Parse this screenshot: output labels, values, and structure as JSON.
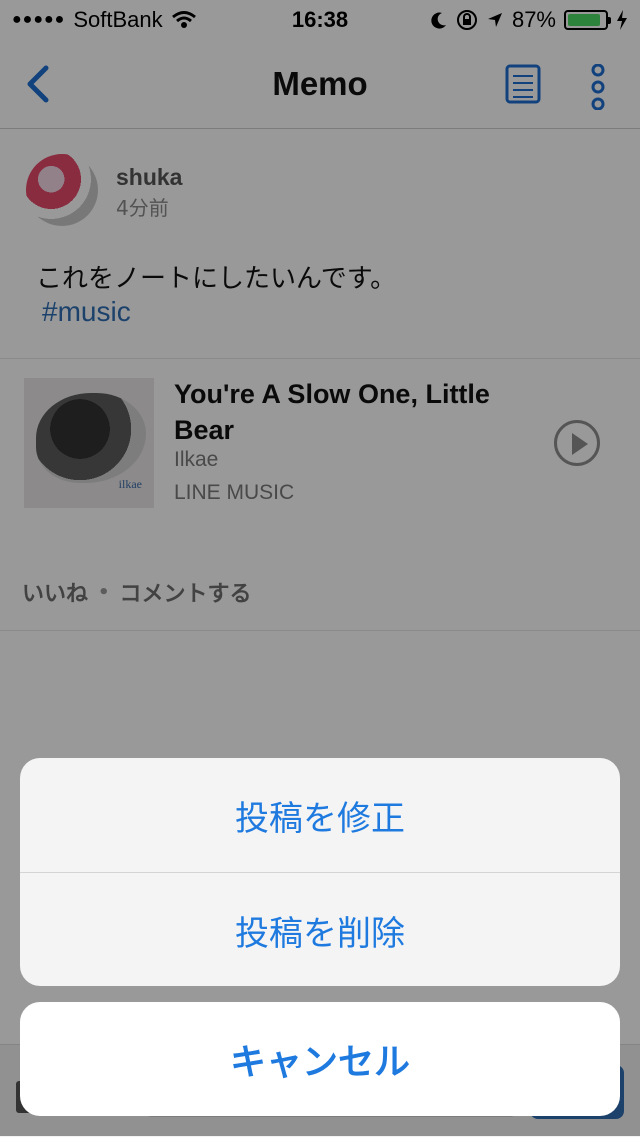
{
  "status_bar": {
    "carrier": "SoftBank",
    "time": "16:38",
    "battery": "87%"
  },
  "nav": {
    "title": "Memo"
  },
  "post": {
    "username": "shuka",
    "time": "4分前",
    "text": "これをノートにしたいんです。",
    "hashtag": "#music"
  },
  "music": {
    "title": "You're A Slow One, Little Bear",
    "artist": "Ilkae",
    "service": "LINE MUSIC",
    "album_label": "ilkae"
  },
  "actions": {
    "like": "いいね",
    "separator": "•",
    "comment": "コメントする"
  },
  "sheet": {
    "edit": "投稿を修正",
    "delete": "投稿を削除",
    "cancel": "キャンセル"
  }
}
